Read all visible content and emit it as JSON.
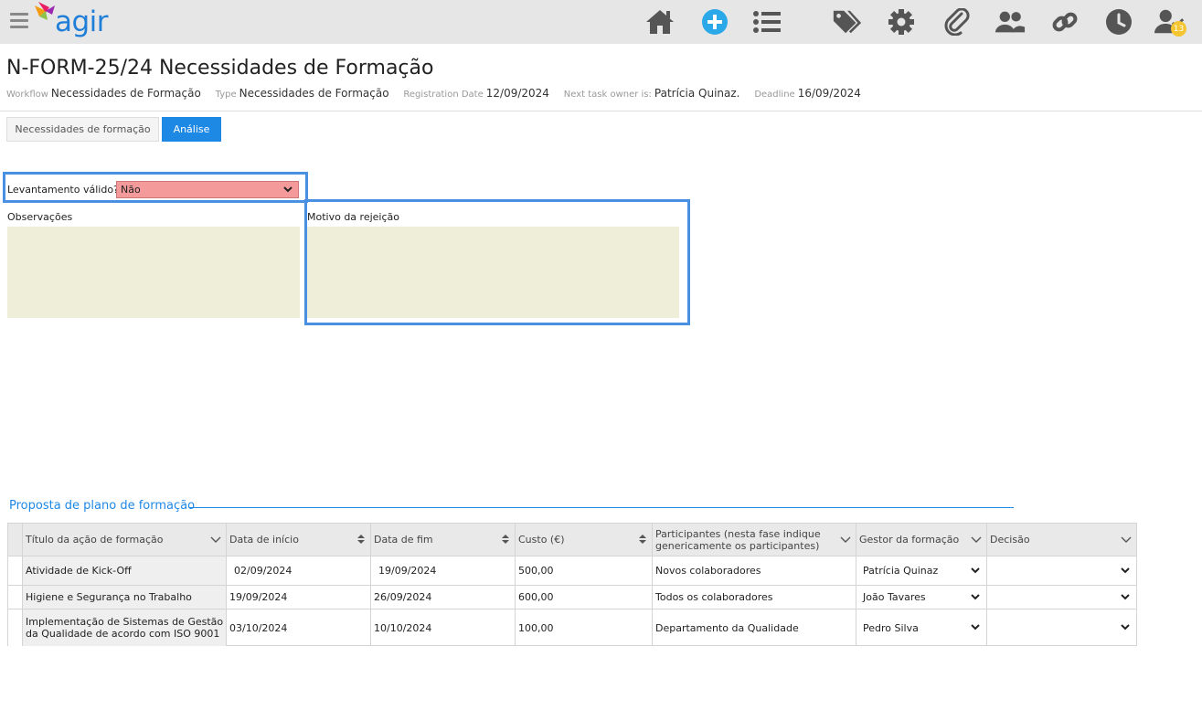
{
  "app": {
    "logo_text": "agir",
    "notification_count": "13",
    "nav_icons": [
      "home-icon",
      "add-circle-icon",
      "list-icon",
      "tags-icon",
      "gear-icon",
      "paperclip-icon",
      "users-icon",
      "link-icon",
      "clock-icon",
      "user-check-icon"
    ],
    "colors": {
      "accent": "#1e88e5",
      "add_icon": "#2ba8e8",
      "topbar": "#e6e6e6",
      "badge": "#f5c531"
    }
  },
  "header": {
    "title": "N-FORM-25/24 Necessidades de Formação",
    "meta": [
      {
        "label": "Workflow",
        "value": "Necessidades de Formação"
      },
      {
        "label": "Type",
        "value": "Necessidades de Formação"
      },
      {
        "label": "Registration Date",
        "value": "12/09/2024"
      },
      {
        "label": "Next task owner is:",
        "value": "Patrícia Quinaz."
      },
      {
        "label": "Deadline",
        "value": "16/09/2024"
      }
    ]
  },
  "tabs": [
    {
      "label": "Necessidades de formação",
      "active": false
    },
    {
      "label": "Análise",
      "active": true
    }
  ],
  "form": {
    "valid_label": "Levantamento válido?",
    "valid_value": "Não",
    "obs_label": "Observações",
    "obs_value": "",
    "reason_label": "Motivo da rejeição",
    "reason_value": ""
  },
  "section": {
    "title": "Proposta de plano de formação"
  },
  "table": {
    "columns": [
      {
        "label": "Título da ação de formação",
        "icon": "chevron-down-icon"
      },
      {
        "label": "Data de início",
        "icon": "sort-icon"
      },
      {
        "label": "Data de fim",
        "icon": "sort-icon"
      },
      {
        "label": "Custo (€)",
        "icon": "sort-icon"
      },
      {
        "label": "Participantes (nesta fase indique genericamente os participantes)",
        "icon": "chevron-down-icon"
      },
      {
        "label": "Gestor da formação",
        "icon": "chevron-down-icon"
      },
      {
        "label": "Decisão",
        "icon": "chevron-down-icon"
      }
    ],
    "rows": [
      {
        "title": "Atividade de Kick-Off",
        "start": "02/09/2024",
        "end": "19/09/2024",
        "cost": "500,00",
        "participants": "Novos colaboradores",
        "manager": "Patrícia Quinaz",
        "decision": ""
      },
      {
        "title": "Higiene e Segurança no Trabalho",
        "start": "19/09/2024",
        "end": "26/09/2024",
        "cost": "600,00",
        "participants": "Todos os colaboradores",
        "manager": "João Tavares",
        "decision": ""
      },
      {
        "title": "Implementação de Sistemas de Gestão da Qualidade de acordo com ISO 9001",
        "start": "03/10/2024",
        "end": "10/10/2024",
        "cost": "100,00",
        "participants": "Departamento da Qualidade",
        "manager": "Pedro Silva",
        "decision": ""
      }
    ]
  }
}
